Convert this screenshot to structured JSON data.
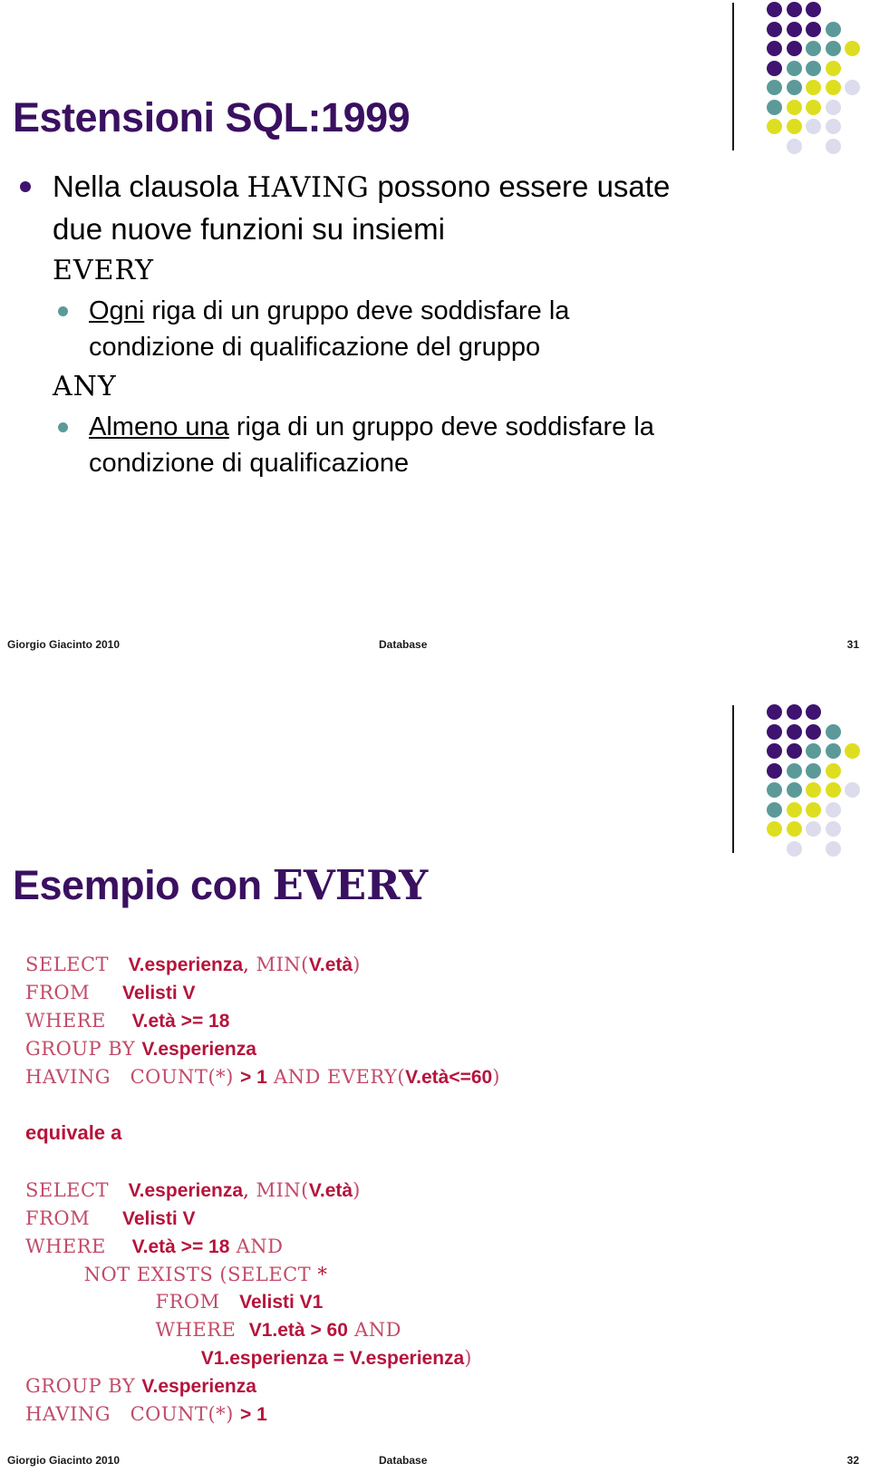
{
  "deck": {
    "theme": {
      "title_color": "#3a1060",
      "sql_keyword_color": "#c24b6a",
      "sql_identifier_color": "#b5143c",
      "bullet_level1_color": "#3f1370",
      "bullet_level2_color": "#5c9a9a",
      "deco_colors": [
        "#3f1370",
        "#5c9a9a",
        "#dede20",
        "#dcdcec"
      ]
    }
  },
  "slide1": {
    "title": "Estensioni SQL:1999",
    "bullets": {
      "b1_a": "Nella clausola ",
      "b1_kw": "HAVING",
      "b1_b": " possono essere usate",
      "b1_line2": "due nuove funzioni su insiemi",
      "kw_every": "EVERY",
      "sub1_underline": "Ogni",
      "sub1_rest": " riga di un gruppo deve soddisfare la",
      "sub1_line2": "condizione di qualificazione del gruppo",
      "kw_any": "ANY",
      "sub2_underline": "Almeno una",
      "sub2_rest": " riga di un gruppo deve soddisfare la",
      "sub2_line2": "condizione di qualificazione"
    },
    "footer": {
      "left": "Giorgio Giacinto 2010",
      "center": "Database",
      "right": "31"
    }
  },
  "slide2": {
    "title_text": "Esempio con ",
    "title_kw": "EVERY",
    "equivale": "equivale a",
    "query1": [
      [
        {
          "t": "SELECT   ",
          "c": "k"
        },
        {
          "t": "V.esperienza",
          "c": "id"
        },
        {
          "t": ", ",
          "c": "k-dark"
        },
        {
          "t": "MIN(",
          "c": "k"
        },
        {
          "t": "V.età",
          "c": "id"
        },
        {
          "t": ")",
          "c": "k"
        }
      ],
      [
        {
          "t": "FROM     ",
          "c": "k"
        },
        {
          "t": "Velisti V",
          "c": "id"
        }
      ],
      [
        {
          "t": "WHERE    ",
          "c": "k"
        },
        {
          "t": "V.età >= 18",
          "c": "id"
        }
      ],
      [
        {
          "t": "GROUP BY ",
          "c": "k"
        },
        {
          "t": "V.esperienza",
          "c": "id"
        }
      ],
      [
        {
          "t": "HAVING   ",
          "c": "k"
        },
        {
          "t": "COUNT(*)",
          "c": "k"
        },
        {
          "t": " ",
          "c": "k"
        },
        {
          "t": "> 1",
          "c": "id"
        },
        {
          "t": " AND EVERY(",
          "c": "k"
        },
        {
          "t": "V.età<=60",
          "c": "id"
        },
        {
          "t": ")",
          "c": "k"
        }
      ]
    ],
    "query2": [
      [
        {
          "t": "SELECT   ",
          "c": "k"
        },
        {
          "t": "V.esperienza",
          "c": "id"
        },
        {
          "t": ", ",
          "c": "k-dark"
        },
        {
          "t": "MIN(",
          "c": "k"
        },
        {
          "t": "V.età",
          "c": "id"
        },
        {
          "t": ")",
          "c": "k"
        }
      ],
      [
        {
          "t": "FROM     ",
          "c": "k"
        },
        {
          "t": "Velisti V",
          "c": "id"
        }
      ],
      [
        {
          "t": "WHERE    ",
          "c": "k"
        },
        {
          "t": "V.età >= 18",
          "c": "id"
        },
        {
          "t": " AND",
          "c": "k"
        }
      ],
      [
        {
          "t": "         NOT EXISTS (SELECT ",
          "c": "k"
        },
        {
          "t": "*",
          "c": "k-dark"
        }
      ],
      [
        {
          "t": "                    FROM   ",
          "c": "k"
        },
        {
          "t": "Velisti V1",
          "c": "id"
        }
      ],
      [
        {
          "t": "                    WHERE  ",
          "c": "k"
        },
        {
          "t": "V1.età > 60",
          "c": "id"
        },
        {
          "t": " AND",
          "c": "k"
        }
      ],
      [
        {
          "t": "                           ",
          "c": "k"
        },
        {
          "t": "V1.esperienza = V.esperienza",
          "c": "id"
        },
        {
          "t": ")",
          "c": "k"
        }
      ],
      [
        {
          "t": "GROUP BY ",
          "c": "k"
        },
        {
          "t": "V.esperienza",
          "c": "id"
        }
      ],
      [
        {
          "t": "HAVING   ",
          "c": "k"
        },
        {
          "t": "COUNT(*)",
          "c": "k"
        },
        {
          "t": " ",
          "c": "k"
        },
        {
          "t": "> 1",
          "c": "id"
        }
      ]
    ],
    "footer": {
      "left": "Giorgio Giacinto 2010",
      "center": "Database",
      "right": "32"
    }
  },
  "deco_grid": [
    [
      "p",
      "p",
      "p",
      "",
      ""
    ],
    [
      "p",
      "p",
      "p",
      "t",
      ""
    ],
    [
      "p",
      "p",
      "t",
      "t",
      "y"
    ],
    [
      "p",
      "t",
      "t",
      "y",
      ""
    ],
    [
      "t",
      "t",
      "y",
      "y",
      "l"
    ],
    [
      "t",
      "y",
      "y",
      "l",
      ""
    ],
    [
      "y",
      "y",
      "l",
      "l",
      ""
    ],
    [
      "",
      "l",
      "",
      "l",
      ""
    ]
  ]
}
